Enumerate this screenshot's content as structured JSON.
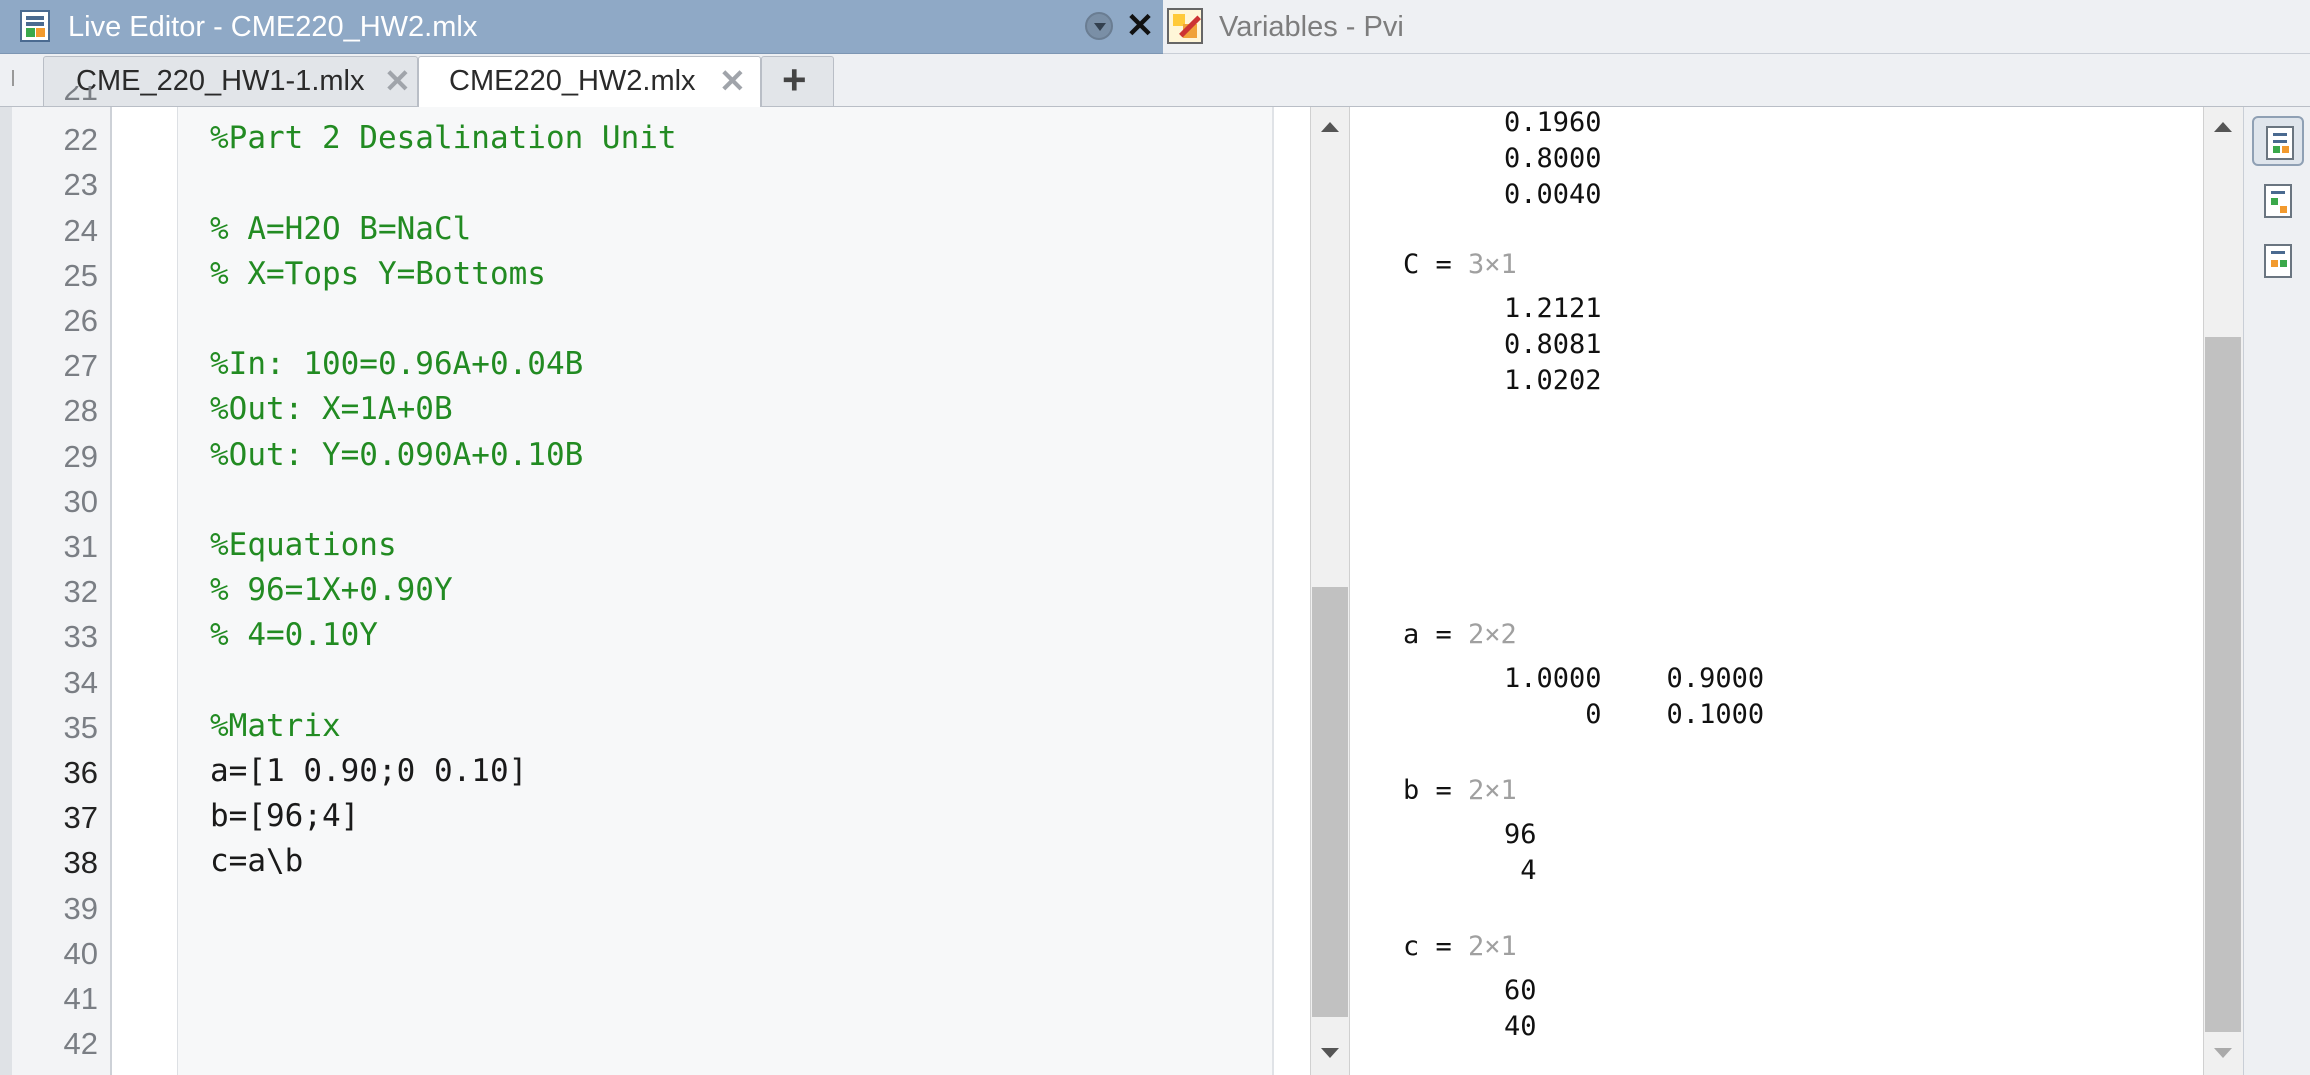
{
  "window": {
    "app_title": "Live Editor - CME220_HW2.mlx",
    "variables_title": "Variables - Pvi"
  },
  "tabs": [
    {
      "label": "CME_220_HW1-1.mlx",
      "active": false
    },
    {
      "label": "CME220_HW2.mlx",
      "active": true
    }
  ],
  "editor": {
    "lines": [
      {
        "num": "21",
        "text": ""
      },
      {
        "num": "22",
        "text": "%Part 2 Desalination Unit"
      },
      {
        "num": "23",
        "text": ""
      },
      {
        "num": "24",
        "text": "% A=H2O B=NaCl"
      },
      {
        "num": "25",
        "text": "% X=Tops Y=Bottoms"
      },
      {
        "num": "26",
        "text": ""
      },
      {
        "num": "27",
        "text": "%In: 100=0.96A+0.04B"
      },
      {
        "num": "28",
        "text": "%Out: X=1A+0B"
      },
      {
        "num": "29",
        "text": "%Out: Y=0.090A+0.10B"
      },
      {
        "num": "30",
        "text": ""
      },
      {
        "num": "31",
        "text": "%Equations"
      },
      {
        "num": "32",
        "text": "% 96=1X+0.90Y"
      },
      {
        "num": "33",
        "text": "% 4=0.10Y"
      },
      {
        "num": "34",
        "text": ""
      },
      {
        "num": "35",
        "text": "%Matrix"
      },
      {
        "num": "36",
        "text": "a=[1 0.90;0 0.10]"
      },
      {
        "num": "37",
        "text": "b=[96;4]"
      },
      {
        "num": "38",
        "text": "c=a\\b"
      },
      {
        "num": "39",
        "text": ""
      },
      {
        "num": "40",
        "text": ""
      },
      {
        "num": "41",
        "text": ""
      },
      {
        "num": "42",
        "text": ""
      }
    ]
  },
  "output": {
    "top_values": [
      "0.1960",
      "0.8000",
      "0.0040"
    ],
    "C": {
      "label": "C = ",
      "size": "3×1",
      "values": [
        "1.2121",
        "0.8081",
        "1.0202"
      ]
    },
    "a": {
      "label": "a = ",
      "size": "2×2",
      "rows": [
        "1.0000    0.9000",
        "     0    0.1000"
      ]
    },
    "b": {
      "label": "b = ",
      "size": "2×1",
      "values": [
        "96",
        " 4"
      ]
    },
    "c": {
      "label": "c = ",
      "size": "2×1",
      "values": [
        "60",
        "40"
      ]
    }
  },
  "icons": {
    "menu": "dropdown-menu-icon",
    "close": "close-icon",
    "add_tab": "plus-icon",
    "side": [
      "output-inline-icon",
      "output-right-icon",
      "hide-code-icon"
    ]
  },
  "colors": {
    "title_active": "#8fa9c6",
    "comment": "#228b22",
    "code": "#1a1a1a"
  }
}
